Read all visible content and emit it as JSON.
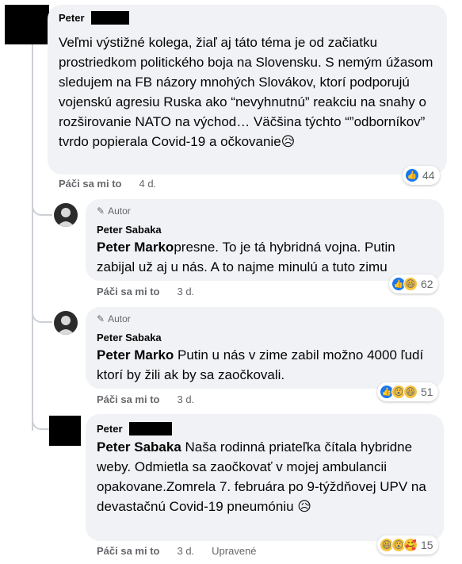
{
  "comments": [
    {
      "author": "Peter",
      "text": "Veľmi výstižné kolega, žiaľ aj táto téma je od začiatku prostriedkom politického boja na Slovensku. S nemým úžasom sledujem na FB názory mnohých Slovákov, ktorí podporujú vojenskú agresiu Ruska ako “nevyhnutnú” reakciu na snahy o rozširovanie NATO na východ… Väčšina týchto “”odborníkov” tvrdo popierala Covid-19 a očkovanie😥",
      "like_label": "Páči sa mi to",
      "time": "4 d.",
      "reaction_count": "44"
    }
  ],
  "replies": [
    {
      "badge": "Autor",
      "author": "Peter Sabaka",
      "mention": "Peter Marko",
      "text": "presne. To je tá hybridná vojna. Putin zabijal už aj u nás. A to najme minulú a tuto zimu",
      "like_label": "Páči sa mi to",
      "time": "3 d.",
      "reaction_count": "62"
    },
    {
      "badge": "Autor",
      "author": "Peter Sabaka",
      "mention": "Peter Marko",
      "text": " Putin u nás v zime zabil možno 4000 ľudí ktorí by žili ak by sa zaočkovali.",
      "like_label": "Páči sa mi to",
      "time": "3 d.",
      "reaction_count": "51"
    },
    {
      "author": "Peter",
      "mention": "Peter Sabaka",
      "text": " Naša rodinná priateľka čítala hybridne weby. Odmietla sa zaočkovať v mojej ambulancii opakovane.Zomrela 7. februára po 9-týždňovej UPV na devastačnú Covid-19 pneumóniu 😥",
      "like_label": "Páči sa mi to",
      "time": "3 d.",
      "edited": "Upravené",
      "reaction_count": "15"
    }
  ],
  "icons": {
    "like": "like-icon",
    "haha": "haha-icon",
    "wow": "wow-icon",
    "care": "care-icon",
    "pencil": "pencil-icon"
  },
  "colors": {
    "bubble": "#f0f2f5",
    "like_blue": "#1877f2",
    "meta_gray": "#65676b"
  }
}
